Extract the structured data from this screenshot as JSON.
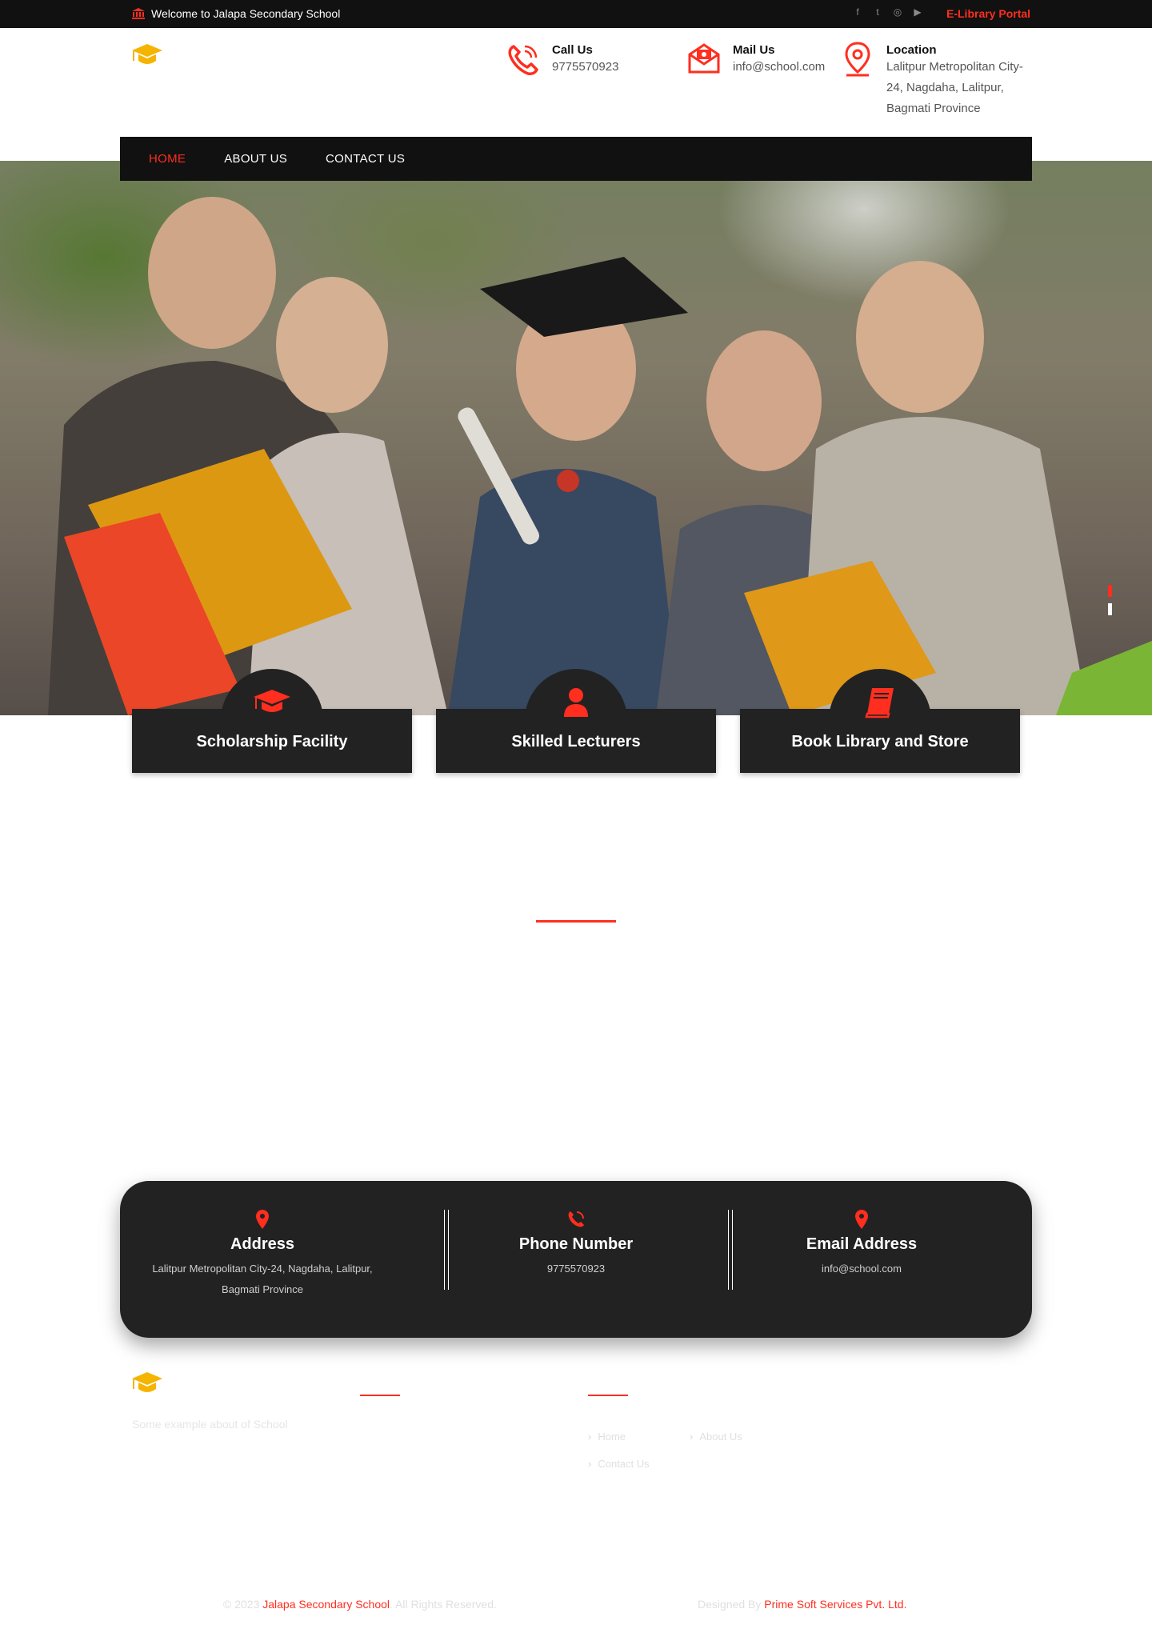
{
  "topbar": {
    "welcome": "Welcome to Jalapa Secondary School",
    "elibrary": "E-Library Portal",
    "social_icons": [
      "facebook-icon",
      "twitter-icon",
      "instagram-icon",
      "youtube-icon"
    ]
  },
  "header": {
    "call": {
      "label": "Call Us",
      "value": "9775570923"
    },
    "mail": {
      "label": "Mail Us",
      "value": "info@school.com"
    },
    "location": {
      "label": "Location",
      "value_lines": [
        "Lalitpur Metropolitan City-",
        "24, Nagdaha, Lalitpur,",
        "Bagmati Province"
      ]
    }
  },
  "nav": {
    "items": [
      {
        "label": "HOME",
        "active": true
      },
      {
        "label": "ABOUT US",
        "active": false
      },
      {
        "label": "CONTACT US",
        "active": false
      }
    ]
  },
  "hero": {
    "slides": 2,
    "active_slide": 1
  },
  "features": [
    {
      "title": "Scholarship Facility",
      "icon": "graduation-cap-icon"
    },
    {
      "title": "Skilled Lecturers",
      "icon": "user-icon"
    },
    {
      "title": "Book Library and Store",
      "icon": "book-icon"
    }
  ],
  "contact_strip": {
    "address": {
      "title": "Address",
      "text": "Lalitpur Metropolitan City-24, Nagdaha, Lalitpur, Bagmati Province"
    },
    "phone": {
      "title": "Phone Number",
      "text": "9775570923"
    },
    "email": {
      "title": "Email Address",
      "text": "info@school.com"
    }
  },
  "footer": {
    "about": "Some example about of School",
    "links": [
      "Home",
      "About Us",
      "Contact Us"
    ],
    "copyright_prefix": "© 2023",
    "copyright_name": "Jalapa Secondary School",
    "copyright_suffix": ". All Rights Reserved.",
    "designed_prefix": "Designed By",
    "designed_name": "Prime Soft Services Pvt. Ltd."
  },
  "colors": {
    "accent": "#ff2e1f",
    "dark": "#111111",
    "card": "#222222",
    "logo": "#f5b400"
  }
}
